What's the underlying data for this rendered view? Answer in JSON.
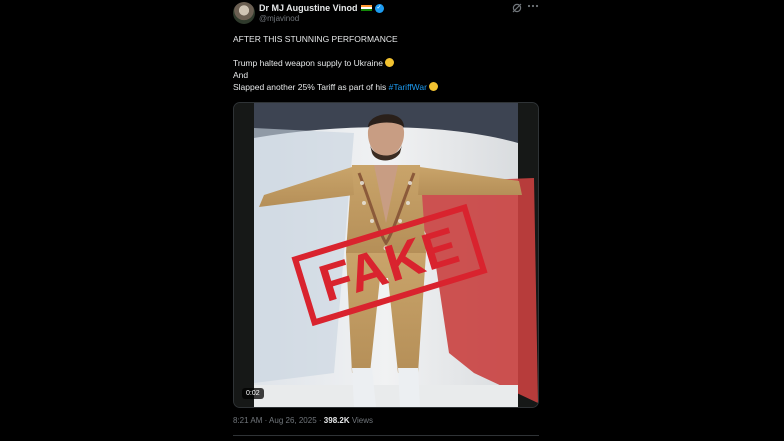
{
  "author": {
    "display_name": "Dr MJ Augustine Vinod",
    "handle": "@mjavinod",
    "flag_colors": [
      "#ff9933",
      "#ffffff",
      "#138808"
    ],
    "verified_color": "#1d9bf0"
  },
  "icons": {
    "grok": "grok-icon",
    "more": "more-icon"
  },
  "text": {
    "line1": "AFTER THIS STUNNING PERFORMANCE",
    "line2": "Trump halted weapon supply to Ukraine",
    "line3": "And",
    "line4_prefix": "Slapped another 25% Tariff as part of his",
    "hashtag": "#TariffWar"
  },
  "media": {
    "stamp": "FAKE",
    "stamp_color": "#d9232e",
    "duration": "0:02"
  },
  "meta": {
    "time": "8:21 AM",
    "sep": "·",
    "date": "Aug 26, 2025",
    "views_count": "398.2K",
    "views_label": "Views"
  }
}
